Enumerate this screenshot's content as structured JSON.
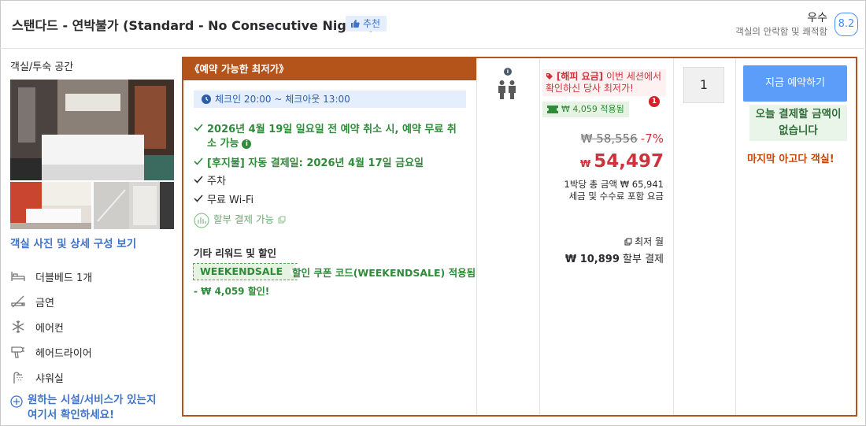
{
  "header": {
    "room_title": "스탠다드 - 연박불가 (Standard - No Consecutive Nights)",
    "recommend_badge": "추천",
    "rating_word": "우수",
    "rating_subtitle": "객실의 안락함 및 쾌적함",
    "rating_score": "8.2"
  },
  "left": {
    "section_title": "객실/투숙 공간",
    "photos_link": "객실 사진 및 상세 구성 보기",
    "amenities": [
      {
        "icon": "bed-icon",
        "label": "더블베드 1개"
      },
      {
        "icon": "no-smoking-icon",
        "label": "금연"
      },
      {
        "icon": "snowflake-icon",
        "label": "에어컨"
      },
      {
        "icon": "hair-dryer-icon",
        "label": "헤어드라이어"
      },
      {
        "icon": "shower-icon",
        "label": "샤워실"
      }
    ],
    "more_link_line1": "원하는 시설/서비스가 있는지",
    "more_link_line2": "여기서 확인하세요!"
  },
  "offer": {
    "ribbon": "《예약 가능한 최저가》",
    "checkin": "체크인 20:00 ~ 체크아웃 13:00",
    "features": {
      "cancel": "2026년 4월 19일 일요일 전 예약 취소 시, 예약 무료 취소 가능",
      "postpay": "[후지불] 자동 결제일: 2026년 4월 17일 금요일",
      "parking": "주차",
      "wifi": "무료 Wi-Fi",
      "installment": "할부 결제 가능"
    },
    "rewards_title": "기타 리워드 및 할인",
    "coupon_code": "WEEKENDSALE",
    "coupon_text": "할인 쿠폰 코드(WEEKENDSALE) 적용됨",
    "coupon_discount": "- ₩ 4,059 할인!"
  },
  "price": {
    "happy_label": "[해피 요금]",
    "happy_text": "이번 세션에서 확인하신 당사 최저가!",
    "applied": "₩ 4,059 적용됨",
    "notif_count": "1",
    "original": "₩ 58,556",
    "discount_pct": "-7%",
    "currency": "₩",
    "final": "54,497",
    "per_night": "1박당 총 금액 ₩ 65,941",
    "taxes": "세금 및 수수료 포함 요금",
    "installment_label": "최저 월",
    "installment_amount": "₩ 10,899",
    "installment_suffix": "할부 결제"
  },
  "booking": {
    "quantity": "1",
    "book_button": "지금 예약하기",
    "no_pay_today": "오늘 결제할 금액이 없습니다",
    "last_chance": "마지막 아고다 객실!"
  }
}
